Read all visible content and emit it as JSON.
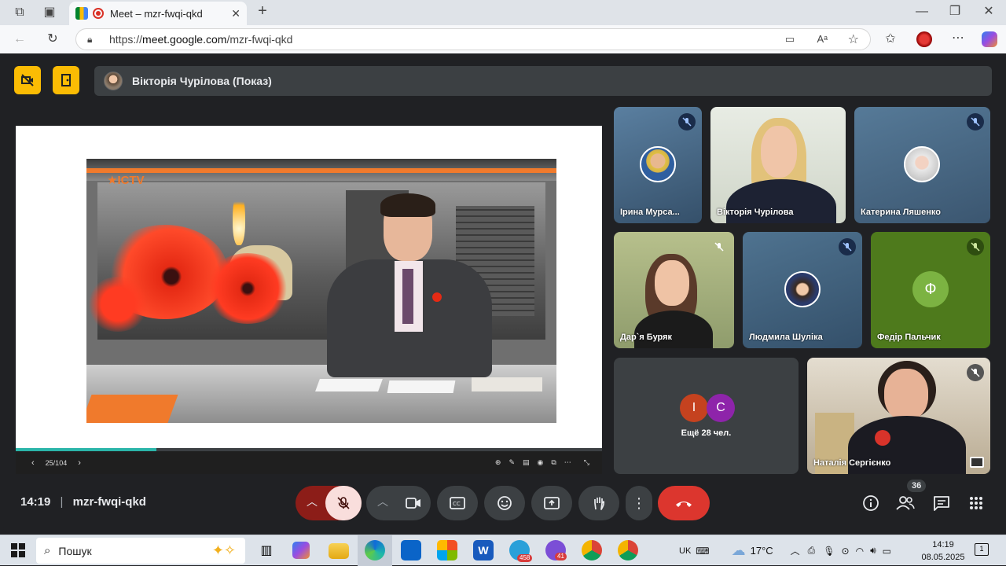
{
  "browser": {
    "tab_title": "Meet – mzr-fwqi-qkd",
    "url_prefix": "https://",
    "url_host": "meet.google.com",
    "url_path": "/mzr-fwqi-qkd"
  },
  "meet": {
    "presenter_label": "Вікторія Чурілова (Показ)",
    "channel_logo": "ICTV",
    "slide_counter": "25/104",
    "slide_progress": 0.24,
    "meeting_time": "14:19",
    "meeting_code": "mzr-fwqi-qkd",
    "participants_count": "36",
    "more_people": "Ещё 28 чел.",
    "tiles": [
      {
        "name": "Ірина Мурса...",
        "muted": true
      },
      {
        "name": "Вікторія Чурілова",
        "muted": false
      },
      {
        "name": "Катерина Ляшенко",
        "muted": true
      },
      {
        "name": "Дар`я Буряк",
        "muted": true
      },
      {
        "name": "Людмила Шуліка",
        "muted": true
      },
      {
        "name": "Федір Пальчик",
        "muted": true,
        "letter": "Ф",
        "letter_color": "#7cb342"
      },
      {
        "name": "Наталія Сергієнко",
        "muted": true
      }
    ],
    "group_letters": [
      {
        "letter": "I",
        "color": "#c5421f"
      },
      {
        "letter": "C",
        "color": "#8e24aa"
      }
    ]
  },
  "taskbar": {
    "search_placeholder": "Пошук",
    "lang": "UK",
    "weather": "17°C",
    "time": "14:19",
    "date": "08.05.2025",
    "telegram_badge": "458",
    "viber_badge": "41",
    "notif_count": "1"
  }
}
